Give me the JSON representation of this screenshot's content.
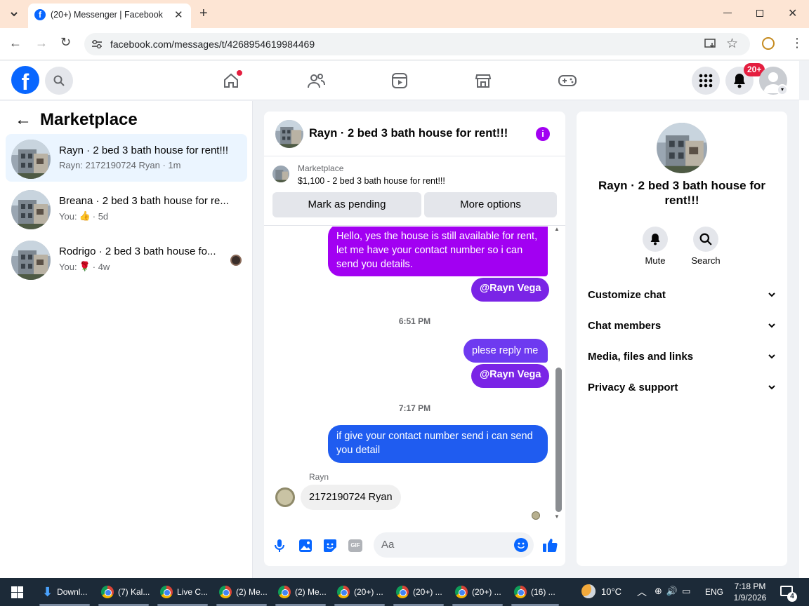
{
  "browser": {
    "tab_title": "(20+) Messenger | Facebook",
    "url": "facebook.com/messages/t/4268954619984469"
  },
  "fb": {
    "notifications_badge": "20+"
  },
  "sidebar": {
    "title": "Marketplace",
    "conversations": [
      {
        "title": "Rayn · 2 bed 3 bath house for rent!!!",
        "preview": "Rayn: 2172190724 Ryan",
        "time": "· 1m"
      },
      {
        "title": "Breana · 2 bed 3 bath house for re...",
        "preview": "You:",
        "time": "· 5d"
      },
      {
        "title": "Rodrigo · 2 bed 3 bath house fo...",
        "preview": "You:",
        "time": "· 4w"
      }
    ]
  },
  "chat": {
    "title": "Rayn · 2 bed 3 bath house for rent!!!",
    "listing_source": "Marketplace",
    "listing": "$1,100 - 2 bed 3 bath house for rent!!!",
    "mark_pending": "Mark as pending",
    "more_options": "More options",
    "msg1": "Hello, yes the house is still available for rent, let me have your contact number so i can send you details.",
    "mention": "@Rayn Vega",
    "time1": "6:51 PM",
    "msg2": "plese reply me",
    "time2": "7:17 PM",
    "msg3": "if give your contact number send i can send you detail",
    "sender": "Rayn",
    "reply": "2172190724 Ryan",
    "input_placeholder": "Aa"
  },
  "details": {
    "title": "Rayn · 2 bed 3 bath house for rent!!!",
    "mute": "Mute",
    "search": "Search",
    "sections": [
      "Customize chat",
      "Chat members",
      "Media, files and links",
      "Privacy & support"
    ]
  },
  "taskbar": {
    "items": [
      "Downl...",
      "(7) Kal...",
      "Live C...",
      "(2) Me...",
      "(2) Me...",
      "(20+) ...",
      "(20+) ...",
      "(20+) ...",
      "(16) ..."
    ],
    "weather": "10°C",
    "lang": "ENG",
    "time": "7:18 PM",
    "date": "1/9/2026",
    "notif_count": "4"
  },
  "colors": {
    "fb_blue": "#0866ff",
    "bubble_purple": "#a200f2",
    "bubble_blue": "#1f5cf0",
    "mention_purple": "#7a24e6"
  }
}
